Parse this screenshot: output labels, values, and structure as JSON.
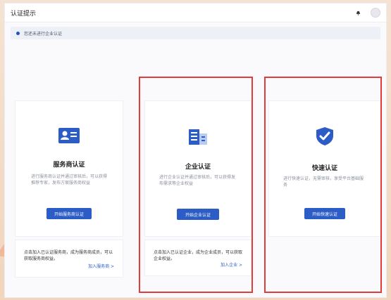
{
  "header": {
    "title": "认证提示"
  },
  "notice": {
    "text": "您还未进行企业认证"
  },
  "cards": [
    {
      "title": "服务商认证",
      "desc": "进行服务商认证并通过审核后，可以获得推荐专家，发布方案服务商权益",
      "button": "开始服务商认证",
      "join_text": "点击加入已认证服务商，成为服务商成员，可以获取服务商权益。",
      "join_link": "加入服务商 >"
    },
    {
      "title": "企业认证",
      "desc": "进行企业认证并通过审核后，可以获得发布需求等企业权益",
      "button": "开始企业认证",
      "join_text": "点击加入已认证企业，成为企业成员，可以获取企业权益。",
      "join_link": "加入企业 >"
    },
    {
      "title": "快速认证",
      "desc": "进行快速认证，无需审核，享受平台基础服务",
      "button": "开始快速认证"
    }
  ],
  "colors": {
    "accent": "#2c5cc5",
    "highlight": "#e23b3b"
  }
}
